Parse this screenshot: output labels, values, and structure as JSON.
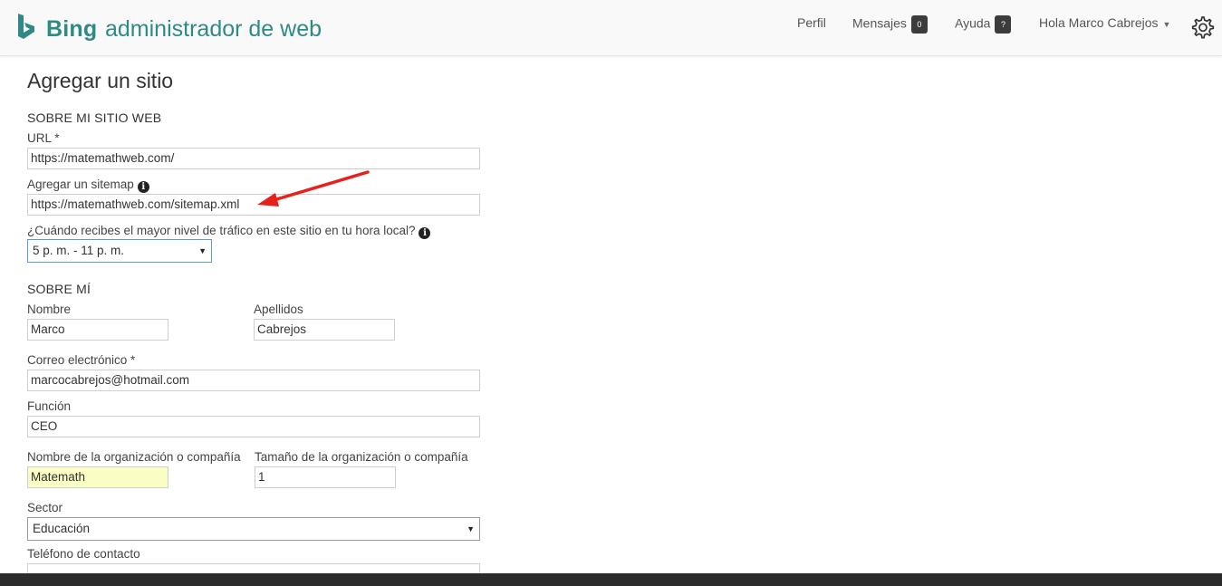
{
  "header": {
    "brand": "Bing",
    "product": "administrador de web",
    "nav": {
      "perfil": "Perfil",
      "mensajes": "Mensajes",
      "mensajes_count": "0",
      "ayuda": "Ayuda",
      "ayuda_badge": "?",
      "user": "Hola Marco Cabrejos"
    },
    "logo_color": "#2f8a86"
  },
  "page": {
    "title": "Agregar un sitio",
    "site_section": "SOBRE MI SITIO WEB",
    "url_label": "URL *",
    "url_value": "https://matemathweb.com/",
    "sitemap_label": "Agregar un sitemap",
    "sitemap_value": "https://matemathweb.com/sitemap.xml",
    "traffic_label": "¿Cuándo recibes el mayor nivel de tráfico en este sitio en tu hora local?",
    "traffic_value": "5 p. m. - 11 p. m.",
    "about_section": "SOBRE MÍ",
    "nombre_label": "Nombre",
    "nombre_value": "Marco",
    "apellidos_label": "Apellidos",
    "apellidos_value": "Cabrejos",
    "correo_label": "Correo electrónico *",
    "correo_value": "marcocabrejos@hotmail.com",
    "funcion_label": "Función",
    "funcion_value": "CEO",
    "org_label": "Nombre de la organización o compañía",
    "org_value": "Matemath",
    "size_label": "Tamaño de la organización o compañía",
    "size_value": "1",
    "sector_label": "Sector",
    "sector_value": "Educación",
    "telefono_label": "Teléfono de contacto",
    "telefono_value": ""
  },
  "annotation": {
    "arrow_color": "#e8201c"
  }
}
